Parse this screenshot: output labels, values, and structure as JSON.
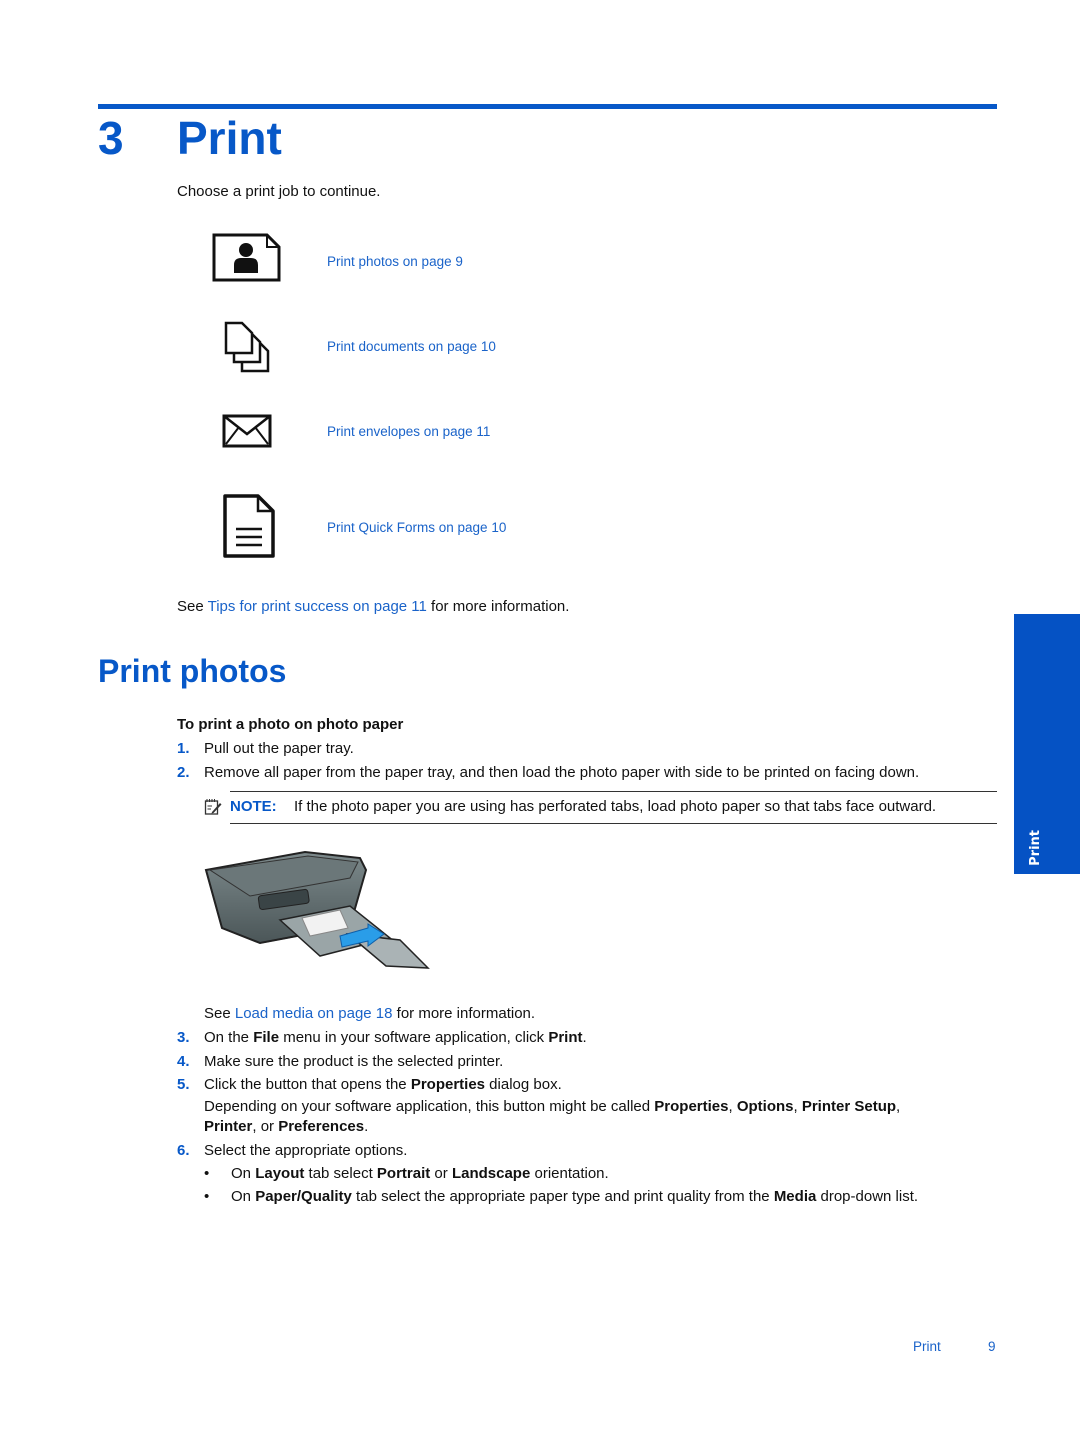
{
  "chapter": {
    "number": "3",
    "title": "Print"
  },
  "intro": "Choose a print job to continue.",
  "print_jobs": [
    {
      "icon": "photo-icon",
      "label": "Print photos on page 9"
    },
    {
      "icon": "documents-icon",
      "label": "Print documents on page 10"
    },
    {
      "icon": "envelope-icon",
      "label": "Print envelopes on page 11"
    },
    {
      "icon": "quick-forms-icon",
      "label": "Print Quick Forms on page 10"
    }
  ],
  "tips": {
    "prefix": "See ",
    "link": "Tips for print success on page 11",
    "suffix": " for more information."
  },
  "section": {
    "title": "Print photos",
    "procedure_title": "To print a photo on photo paper",
    "steps": [
      {
        "num": "1.",
        "text": "Pull out the paper tray."
      },
      {
        "num": "2.",
        "text": "Remove all paper from the paper tray, and then load the photo paper with side to be printed on facing down."
      }
    ],
    "note": {
      "label": "NOTE:",
      "text": "If the photo paper you are using has perforated tabs, load photo paper so that tabs face outward."
    },
    "image_alt": "printer-with-photo-paper-illustration",
    "see_load": {
      "prefix": "See ",
      "link": "Load media on page 18",
      "suffix": " for more information."
    },
    "step3": {
      "num": "3.",
      "t1": "On the ",
      "b1": "File",
      "t2": " menu in your software application, click ",
      "b2": "Print",
      "t3": "."
    },
    "step4": {
      "num": "4.",
      "text": "Make sure the product is the selected printer."
    },
    "step5": {
      "num": "5.",
      "t1": "Click the button that opens the ",
      "b1": "Properties",
      "t2": " dialog box."
    },
    "step5_detail": {
      "t1": "Depending on your software application, this button might be called ",
      "b1": "Properties",
      "t2": ", ",
      "b2": "Options",
      "t3": ", ",
      "b3": "Printer Setup",
      "t4": ",",
      "b4": "Printer",
      "t5": ", or ",
      "b5": "Preferences",
      "t6": "."
    },
    "step6": {
      "num": "6.",
      "text": "Select the appropriate options."
    },
    "bullets": [
      {
        "t1": "On ",
        "b1": "Layout",
        "t2": " tab select ",
        "b2": "Portrait",
        "t3": " or ",
        "b3": "Landscape",
        "t4": " orientation."
      },
      {
        "t1": "On ",
        "b1": "Paper/Quality",
        "t2": " tab select the appropriate paper type and print quality from the ",
        "b2": "Media",
        "t3": " drop-down list."
      }
    ]
  },
  "side_tab": {
    "label": "Print"
  },
  "footer": {
    "section": "Print",
    "page": "9"
  },
  "colors": {
    "accent": "#0758c8",
    "link": "#1a63c9",
    "side_tab": "#0552c4"
  }
}
